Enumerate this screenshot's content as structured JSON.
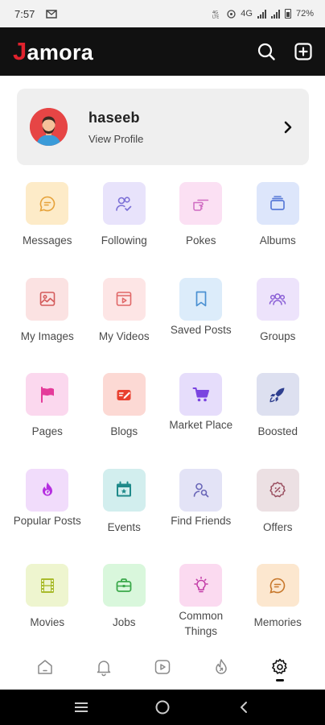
{
  "status_bar": {
    "time": "7:57",
    "net_label": "4G",
    "battery": "72%"
  },
  "header": {
    "logo_initial": "J",
    "logo_rest": "amora"
  },
  "profile": {
    "name": "haseeb",
    "link": "View Profile"
  },
  "menu": [
    {
      "label": "Messages",
      "icon": "message-icon",
      "bg": "#fdebc8",
      "fg": "#e6a23a"
    },
    {
      "label": "Following",
      "icon": "following-icon",
      "bg": "#e8e3fb",
      "fg": "#7b6fd6"
    },
    {
      "label": "Pokes",
      "icon": "poke-icon",
      "bg": "#fbe0f3",
      "fg": "#d06bc2"
    },
    {
      "label": "Albums",
      "icon": "albums-icon",
      "bg": "#dde6fb",
      "fg": "#5a7bd8"
    },
    {
      "label": "My Images",
      "icon": "image-icon",
      "bg": "#fbe2e2",
      "fg": "#d45b5b"
    },
    {
      "label": "My Videos",
      "icon": "video-icon",
      "bg": "#fde5e5",
      "fg": "#e06767"
    },
    {
      "label": "Saved Posts",
      "icon": "bookmark-icon",
      "bg": "#dcecfa",
      "fg": "#4a90d2"
    },
    {
      "label": "Groups",
      "icon": "groups-icon",
      "bg": "#ede3fb",
      "fg": "#8a5fd6"
    },
    {
      "label": "Pages",
      "icon": "flag-icon",
      "bg": "#fbd8ee",
      "fg": "#e43b9a"
    },
    {
      "label": "Blogs",
      "icon": "blog-icon",
      "bg": "#fcd9d4",
      "fg": "#e8402f"
    },
    {
      "label": "Market Place",
      "icon": "cart-icon",
      "bg": "#e6ddfb",
      "fg": "#7a44e0"
    },
    {
      "label": "Boosted",
      "icon": "rocket-icon",
      "bg": "#dde0f0",
      "fg": "#2f3f8f"
    },
    {
      "label": "Popular Posts",
      "icon": "fire-icon",
      "bg": "#f1dcfb",
      "fg": "#b52ee0"
    },
    {
      "label": "Events",
      "icon": "calendar-icon",
      "bg": "#d2eeee",
      "fg": "#1f8a8a"
    },
    {
      "label": "Find Friends",
      "icon": "find-friends-icon",
      "bg": "#e3e3f6",
      "fg": "#6a67b8"
    },
    {
      "label": "Offers",
      "icon": "offer-icon",
      "bg": "#ece0e3",
      "fg": "#9a4f60"
    },
    {
      "label": "Movies",
      "icon": "film-icon",
      "bg": "#eef5cf",
      "fg": "#a9bb2c"
    },
    {
      "label": "Jobs",
      "icon": "briefcase-icon",
      "bg": "#d9f7dc",
      "fg": "#3aa84a"
    },
    {
      "label": "Common Things",
      "icon": "bulb-icon",
      "bg": "#fbdaf0",
      "fg": "#c23aa6"
    },
    {
      "label": "Memories",
      "icon": "memories-icon",
      "bg": "#fce7cf",
      "fg": "#c7772a"
    }
  ],
  "bottom_nav": [
    {
      "name": "nav-home",
      "icon": "home-icon"
    },
    {
      "name": "nav-notifications",
      "icon": "bell-icon"
    },
    {
      "name": "nav-videos",
      "icon": "play-icon"
    },
    {
      "name": "nav-trending",
      "icon": "trending-icon"
    },
    {
      "name": "nav-settings",
      "icon": "gear-icon",
      "active": true
    }
  ]
}
